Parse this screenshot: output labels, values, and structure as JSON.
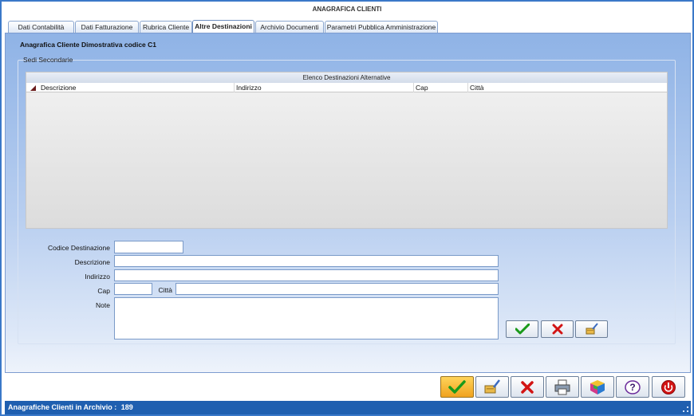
{
  "window": {
    "title": "ANAGRAFICA CLIENTI"
  },
  "tabs": [
    {
      "label": "Dati Contabilità",
      "active": false
    },
    {
      "label": "Dati Fatturazione",
      "active": false
    },
    {
      "label": "Rubrica Cliente",
      "active": false
    },
    {
      "label": "Altre Destinazioni",
      "active": true
    },
    {
      "label": "Archivio Documenti",
      "active": false
    },
    {
      "label": "Parametri Pubblica Amministrazione",
      "active": false
    }
  ],
  "panel": {
    "title": "Anagrafica Cliente Dimostrativa codice C1",
    "group_label": "Sedi Secondarie"
  },
  "grid": {
    "caption": "Elenco Destinazioni Alternative",
    "columns": [
      "Descrizione",
      "Indirizzo",
      "Cap",
      "Città"
    ],
    "rows": []
  },
  "form": {
    "codice_label": "Codice Destinazione",
    "codice_value": "",
    "descrizione_label": "Descrizione",
    "descrizione_value": "",
    "indirizzo_label": "Indirizzo",
    "indirizzo_value": "",
    "cap_label": "Cap",
    "cap_value": "",
    "citta_label": "Città",
    "citta_value": "",
    "note_label": "Note",
    "note_value": ""
  },
  "icons": {
    "confirm": "check-icon",
    "cancel": "x-icon",
    "clear": "broom-icon",
    "print": "printer-icon",
    "cube": "cube-icon",
    "help": "help-icon",
    "exit": "power-icon"
  },
  "colors": {
    "accent": "#1f5fb0",
    "confirm_green": "#1a9a1a",
    "cancel_red": "#d21414",
    "primary_button": "#f0a21e"
  },
  "status": {
    "label": "Anagrafiche Clienti in Archivio :",
    "count": "189"
  }
}
